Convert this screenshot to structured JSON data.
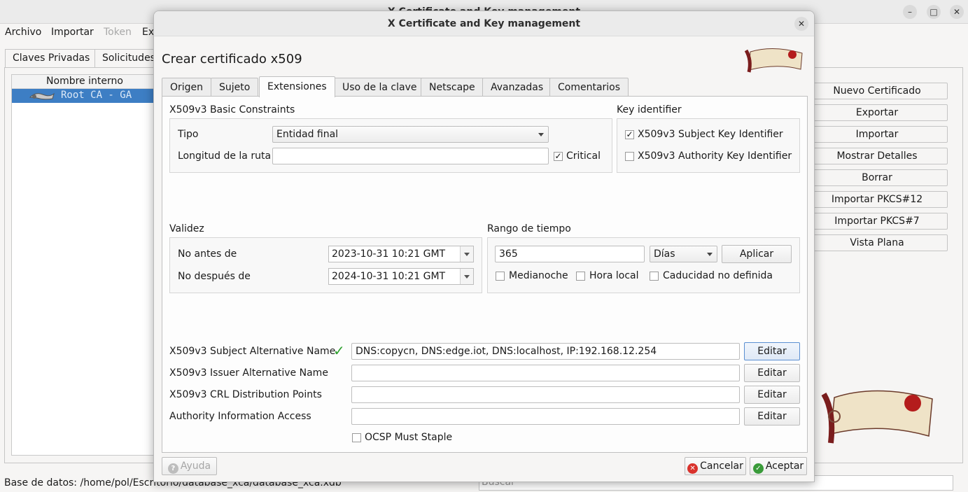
{
  "main_window": {
    "title": "X Certificate and Key management",
    "menu": [
      "Archivo",
      "Importar",
      "Token",
      "Ex"
    ],
    "tabs": [
      "Claves Privadas",
      "Solicitudes"
    ],
    "list_header": "Nombre interno",
    "list_rows": [
      "Root CA - GA"
    ],
    "buttons": [
      "Nuevo Certificado",
      "Exportar",
      "Importar",
      "Mostrar Detalles",
      "Borrar",
      "Importar PKCS#12",
      "Importar PKCS#7",
      "Vista Plana"
    ],
    "status": "Base de datos: /home/pol/Escritorio/database_xca/database_xca.xdb",
    "search_placeholder": "Buscar",
    "controls": {
      "minimize": "–",
      "maximize": "□",
      "close": "✕"
    }
  },
  "dialog": {
    "title": "X Certificate and Key management",
    "close": "✕",
    "heading": "Crear certificado x509",
    "tabs": [
      "Origen",
      "Sujeto",
      "Extensiones",
      "Uso de la clave",
      "Netscape",
      "Avanzadas",
      "Comentarios"
    ],
    "active_tab": "Extensiones",
    "basic_constraints": {
      "label": "X509v3 Basic Constraints",
      "tipo_label": "Tipo",
      "tipo_value": "Entidad final",
      "path_label": "Longitud de la ruta",
      "path_value": "",
      "critical_label": "Critical",
      "critical_checked": true,
      "check_mark": "✓"
    },
    "key_identifier": {
      "label": "Key identifier",
      "subject_label": "X509v3 Subject Key Identifier",
      "subject_checked": true,
      "authority_label": "X509v3 Authority Key Identifier",
      "authority_checked": false
    },
    "validity": {
      "label": "Validez",
      "not_before_label": "No antes de",
      "not_before_value": "2023-10-31 10:21 GMT",
      "not_after_label": "No después de",
      "not_after_value": "2024-10-31 10:21 GMT"
    },
    "time_range": {
      "label": "Rango de tiempo",
      "value": "365",
      "unit": "Días",
      "apply": "Aplicar",
      "midnight_label": "Medianoche",
      "local_time_label": "Hora local",
      "undefined_expiry_label": "Caducidad no definida"
    },
    "alt_names": {
      "san_label": "X509v3 Subject Alternative Name",
      "san_value": "DNS:copycn, DNS:edge.iot, DNS:localhost, IP:192.168.12.254",
      "ian_label": "X509v3 Issuer Alternative Name",
      "ian_value": "",
      "crl_label": "X509v3 CRL Distribution Points",
      "crl_value": "",
      "aia_label": "Authority Information Access",
      "aia_value": "",
      "edit": "Editar",
      "ocsp_label": "OCSP Must Staple",
      "valid_mark": "✓"
    },
    "footer": {
      "help": "Ayuda",
      "cancel": "Cancelar",
      "accept": "Aceptar",
      "help_icon": "?",
      "cancel_icon": "✕",
      "accept_icon": "✓"
    }
  }
}
